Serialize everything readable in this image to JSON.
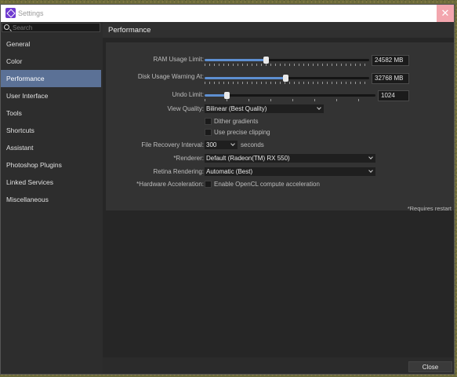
{
  "window": {
    "title": "Settings",
    "close_glyph": "✕",
    "app_icon": "affinity-photo-icon"
  },
  "search": {
    "placeholder": "Search",
    "value": ""
  },
  "sidebar": {
    "items": [
      {
        "label": "General"
      },
      {
        "label": "Color"
      },
      {
        "label": "Performance"
      },
      {
        "label": "User Interface"
      },
      {
        "label": "Tools"
      },
      {
        "label": "Shortcuts"
      },
      {
        "label": "Assistant"
      },
      {
        "label": "Photoshop Plugins"
      },
      {
        "label": "Linked Services"
      },
      {
        "label": "Miscellaneous"
      }
    ],
    "active_index": 2
  },
  "panel": {
    "title": "Performance",
    "ram": {
      "label": "RAM Usage Limit:",
      "value": "24582 MB",
      "level": 0.37
    },
    "disk": {
      "label": "Disk Usage Warning At:",
      "value": "32768 MB",
      "level": 0.49
    },
    "undo": {
      "label": "Undo Limit:",
      "value": "1024",
      "level": 0.13
    },
    "view_quality": {
      "label": "View Quality:",
      "value": "Bilinear (Best Quality)"
    },
    "dither": {
      "label": "Dither gradients",
      "checked": false
    },
    "precise_clipping": {
      "label": "Use precise clipping",
      "checked": false
    },
    "file_recovery": {
      "label": "File Recovery Interval:",
      "value": "300",
      "unit": "seconds"
    },
    "renderer": {
      "label": "*Renderer:",
      "value": "Default (Radeon(TM) RX 550)"
    },
    "retina": {
      "label": "Retina Rendering:",
      "value": "Automatic (Best)"
    },
    "hw_accel": {
      "label": "*Hardware Acceleration:",
      "option": "Enable OpenCL compute acceleration",
      "checked": false
    },
    "note": "*Requires restart"
  },
  "footer": {
    "close_label": "Close"
  },
  "colors": {
    "accent": "#5b7196",
    "slider_fill": "#5e8fd1",
    "background": "#2b2b2b"
  }
}
